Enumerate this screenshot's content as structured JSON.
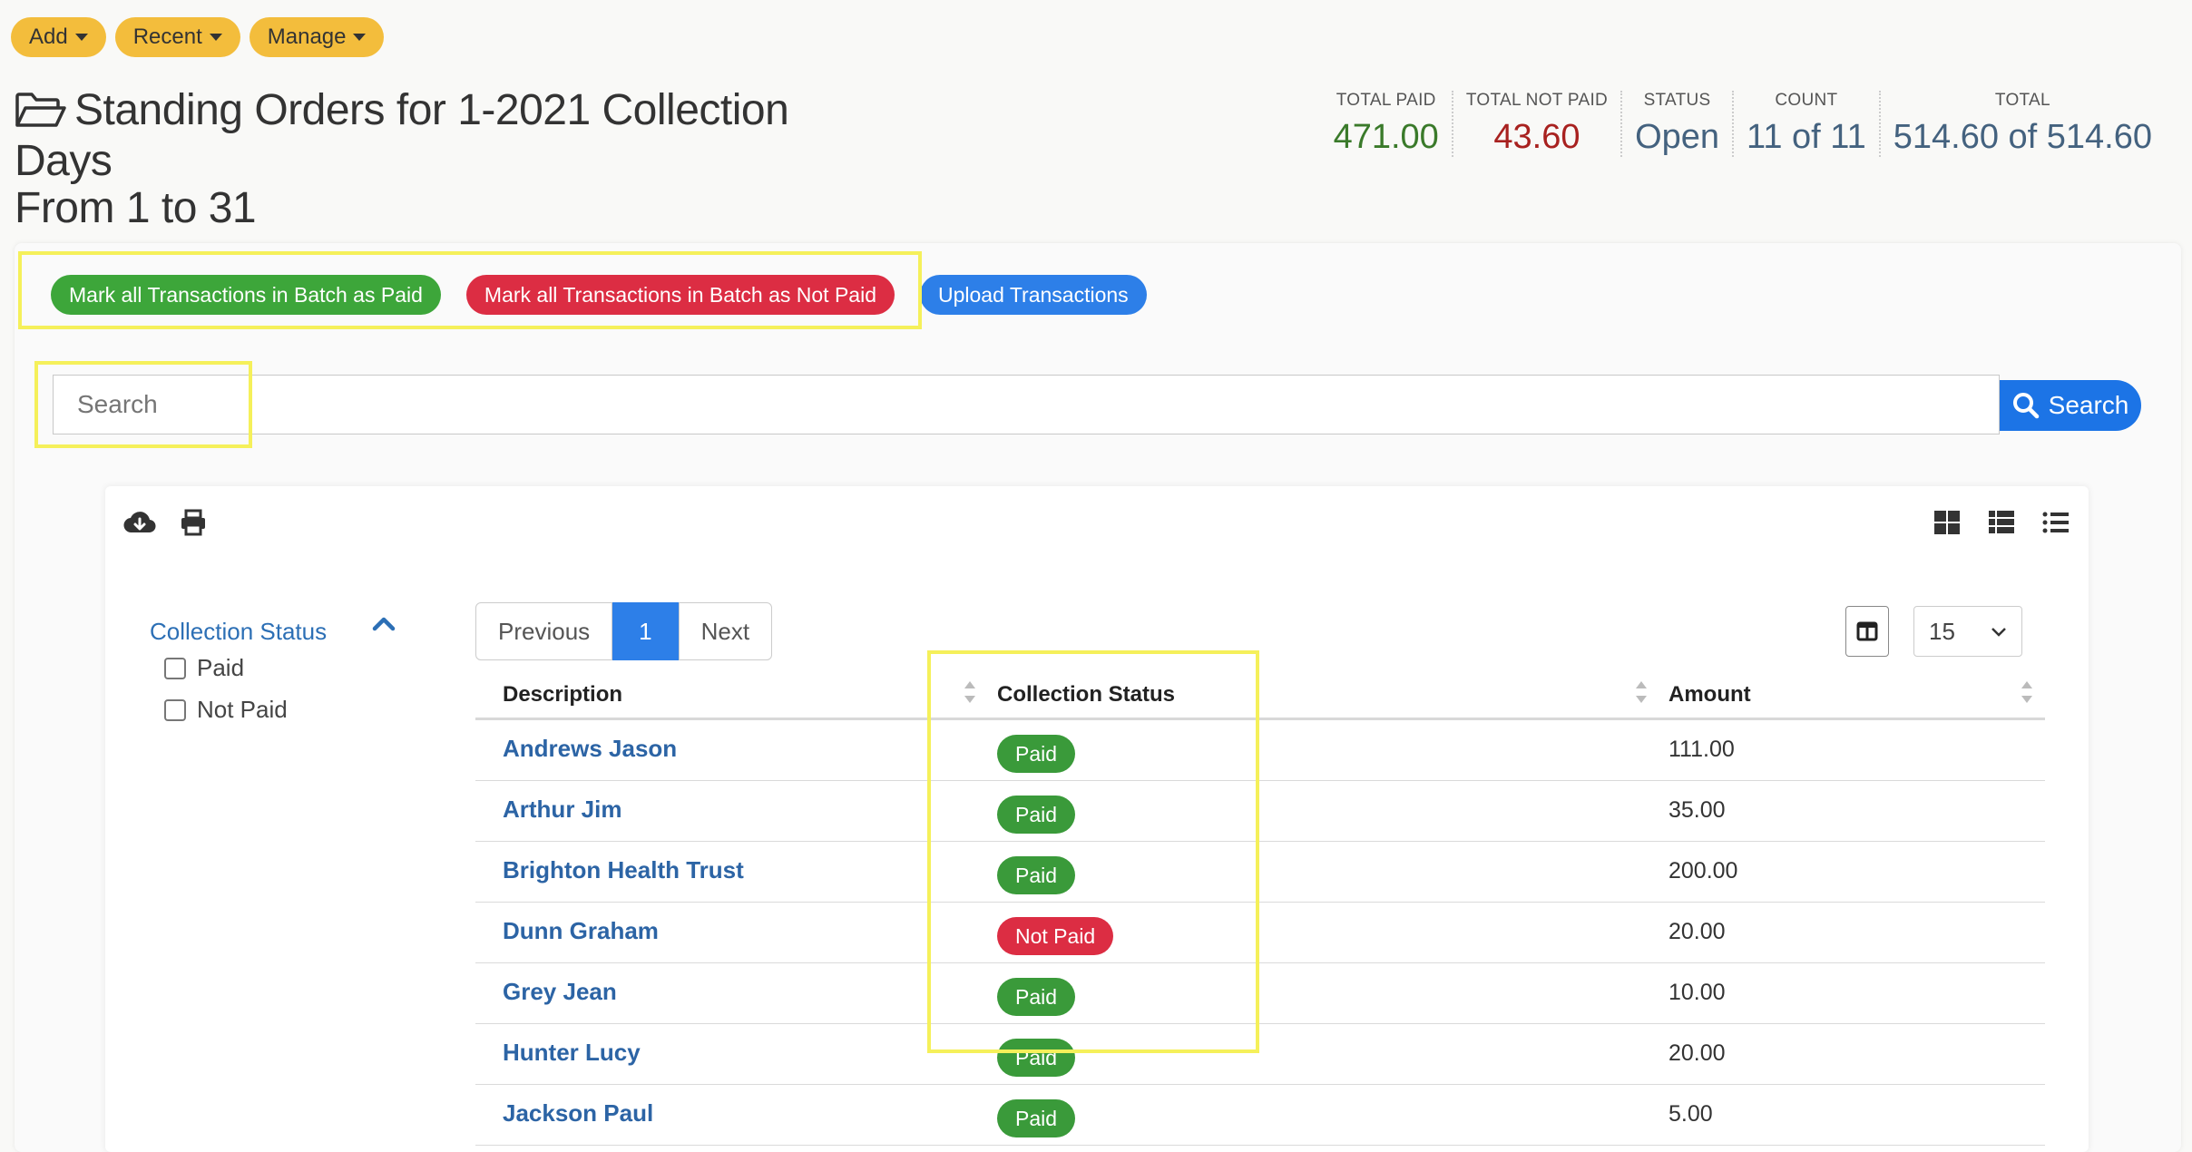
{
  "nav": {
    "add": "Add",
    "recent": "Recent",
    "manage": "Manage"
  },
  "page": {
    "title_line1": "Standing Orders for 1-2021 Collection Days",
    "title_line2": "From 1 to 31"
  },
  "stats": [
    {
      "label": "TOTAL PAID",
      "value": "471.00",
      "color": "#3a7a2a"
    },
    {
      "label": "TOTAL NOT PAID",
      "value": "43.60",
      "color": "#a8211f"
    },
    {
      "label": "STATUS",
      "value": "Open",
      "color": "#44627f"
    },
    {
      "label": "COUNT",
      "value": "11 of 11",
      "color": "#44627f"
    },
    {
      "label": "TOTAL",
      "value": "514.60 of 514.60",
      "color": "#44627f"
    }
  ],
  "actions": {
    "mark_paid": "Mark all Transactions in Batch as Paid",
    "mark_not_paid": "Mark all Transactions in Batch as Not Paid",
    "upload": "Upload Transactions"
  },
  "search": {
    "placeholder": "Search",
    "button": "Search"
  },
  "facet": {
    "title": "Collection Status",
    "options": [
      "Paid",
      "Not Paid"
    ]
  },
  "pager": {
    "previous": "Previous",
    "current": "1",
    "next": "Next"
  },
  "per_page": "15",
  "table": {
    "headers": {
      "description": "Description",
      "status": "Collection Status",
      "amount": "Amount"
    },
    "rows": [
      {
        "name": "Andrews Jason",
        "status": "Paid",
        "amount": "111.00"
      },
      {
        "name": "Arthur Jim",
        "status": "Paid",
        "amount": "35.00"
      },
      {
        "name": "Brighton Health Trust",
        "status": "Paid",
        "amount": "200.00"
      },
      {
        "name": "Dunn Graham",
        "status": "Not Paid",
        "amount": "20.00"
      },
      {
        "name": "Grey Jean",
        "status": "Paid",
        "amount": "10.00"
      },
      {
        "name": "Hunter Lucy",
        "status": "Paid",
        "amount": "20.00"
      },
      {
        "name": "Jackson Paul",
        "status": "Paid",
        "amount": "5.00"
      }
    ]
  },
  "colors": {
    "brand_yellow": "#f3bd3c",
    "paid_green": "#3a9a3a",
    "not_paid_red": "#dc2d43",
    "primary_blue": "#2d7fe8",
    "highlight": "#f5f05a"
  }
}
